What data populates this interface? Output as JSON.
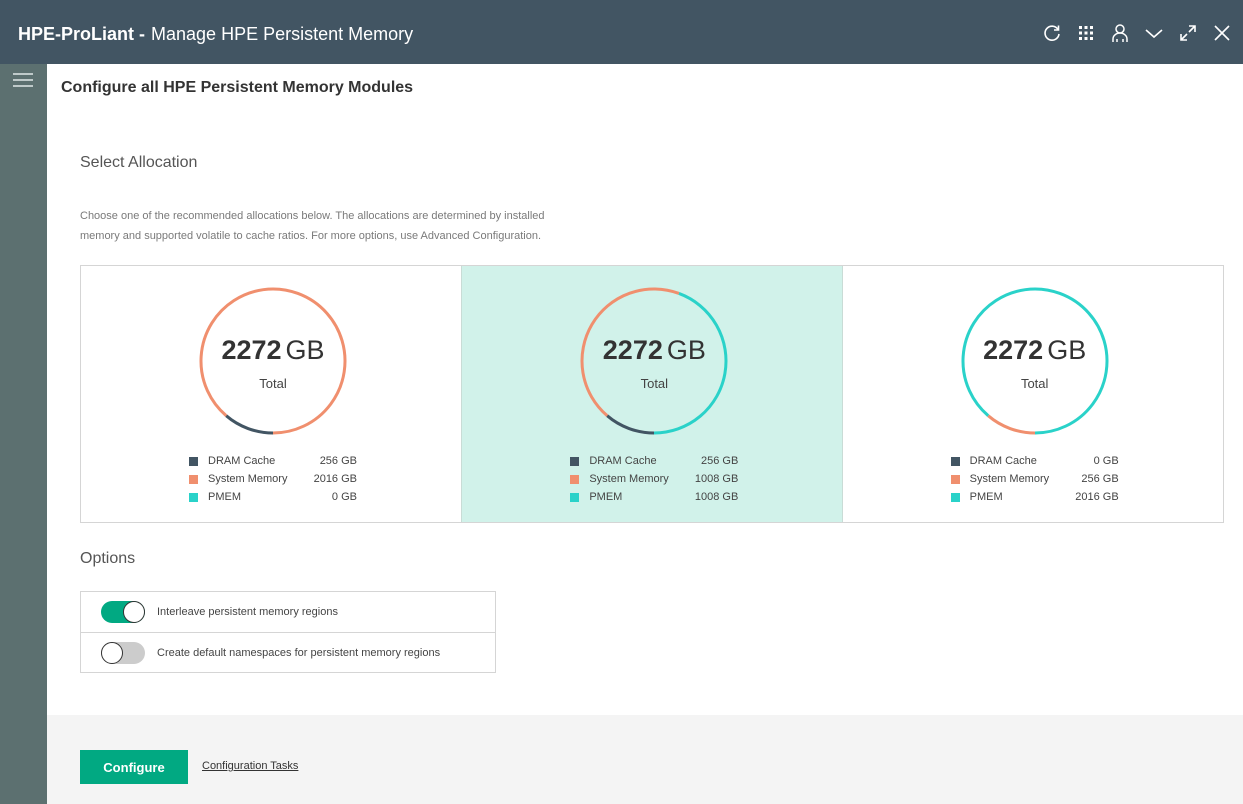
{
  "window": {
    "brand": "HPE-ProLiant -",
    "title": "Manage HPE Persistent Memory"
  },
  "header_icons": [
    "refresh-icon",
    "apps-grid-icon",
    "user-icon",
    "chevron-down-icon",
    "expand-icon",
    "close-icon"
  ],
  "page": {
    "title": "Configure all HPE Persistent Memory Modules"
  },
  "allocation": {
    "section_title": "Select Allocation",
    "description_line1": "Choose one of the recommended allocations below. The allocations are determined by installed",
    "description_line2": "memory and supported volatile to cache ratios. For more options, use Advanced Configuration.",
    "options": [
      {
        "total_value": "2272",
        "total_unit": "GB",
        "total_label": "Total",
        "selected": false,
        "legend": [
          {
            "label": "DRAM Cache",
            "value": "256 GB"
          },
          {
            "label": "System Memory",
            "value": "2016 GB"
          },
          {
            "label": "PMEM",
            "value": "0 GB"
          }
        ]
      },
      {
        "total_value": "2272",
        "total_unit": "GB",
        "total_label": "Total",
        "selected": true,
        "legend": [
          {
            "label": "DRAM Cache",
            "value": "256 GB"
          },
          {
            "label": "System Memory",
            "value": "1008 GB"
          },
          {
            "label": "PMEM",
            "value": "1008 GB"
          }
        ]
      },
      {
        "total_value": "2272",
        "total_unit": "GB",
        "total_label": "Total",
        "selected": false,
        "legend": [
          {
            "label": "DRAM Cache",
            "value": "0 GB"
          },
          {
            "label": "System Memory",
            "value": "256 GB"
          },
          {
            "label": "PMEM",
            "value": "2016 GB"
          }
        ]
      }
    ]
  },
  "chart_data": [
    {
      "type": "pie",
      "categories": [
        "DRAM Cache",
        "System Memory",
        "PMEM"
      ],
      "values": [
        256,
        2016,
        0
      ],
      "title": "2272 GB"
    },
    {
      "type": "pie",
      "categories": [
        "DRAM Cache",
        "System Memory",
        "PMEM"
      ],
      "values": [
        256,
        1008,
        1008
      ],
      "title": "2272 GB"
    },
    {
      "type": "pie",
      "categories": [
        "DRAM Cache",
        "System Memory",
        "PMEM"
      ],
      "values": [
        0,
        256,
        2016
      ],
      "title": "2272 GB"
    }
  ],
  "colors": {
    "dram_cache": "#425563",
    "system_memory": "#f08f6e",
    "pmem": "#2ad2c9",
    "accent": "#01a982",
    "selected_bg": "#d1f2ea"
  },
  "options": {
    "section_title": "Options",
    "items": [
      {
        "label": "Interleave persistent memory regions",
        "enabled": true
      },
      {
        "label": "Create default namespaces for persistent memory regions",
        "enabled": false
      }
    ]
  },
  "footer": {
    "configure_label": "Configure",
    "tasks_link": "Configuration Tasks"
  }
}
